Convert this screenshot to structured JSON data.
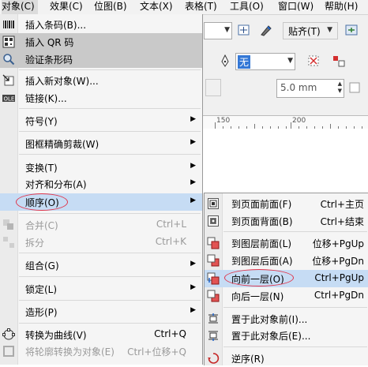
{
  "menubar": [
    {
      "label": "对象(C)",
      "active": true
    },
    {
      "label": "效果(C)"
    },
    {
      "label": "位图(B)"
    },
    {
      "label": "文本(X)"
    },
    {
      "label": "表格(T)"
    },
    {
      "label": "工具(O)"
    },
    {
      "label": "窗口(W)"
    },
    {
      "label": "帮助(H)"
    }
  ],
  "toolbar": {
    "snap_label": "贴齐(T)",
    "outline_value": "无",
    "size_value": "5.0 mm",
    "ruler_labels": [
      "150",
      "200"
    ]
  },
  "menu": {
    "items": [
      {
        "label": "插入条码(B)...",
        "icon": "barcode-icon"
      },
      {
        "label": "插入 QR 码",
        "icon": "qr-code-icon",
        "state": "hover"
      },
      {
        "label": "验证条形码",
        "icon": "magnify-icon",
        "state": "hover"
      },
      {
        "label": "插入新对象(W)...",
        "icon": "insert-object-icon"
      },
      {
        "label": "链接(K)...",
        "icon": "ole-icon"
      },
      {
        "label": "符号(Y)",
        "submenu": true
      },
      {
        "label": "图框精确剪裁(W)",
        "submenu": true
      },
      {
        "label": "变换(T)",
        "submenu": true
      },
      {
        "label": "对齐和分布(A)",
        "submenu": true
      },
      {
        "label": "顺序(O)",
        "submenu": true,
        "state": "open"
      },
      {
        "label": "合并(C)",
        "shortcut": "Ctrl+L",
        "disabled": true,
        "icon": "combine-icon"
      },
      {
        "label": "拆分",
        "shortcut": "Ctrl+K",
        "disabled": true,
        "icon": "break-apart-icon"
      },
      {
        "label": "组合(G)",
        "submenu": true
      },
      {
        "label": "锁定(L)",
        "submenu": true
      },
      {
        "label": "造形(P)",
        "submenu": true
      },
      {
        "label": "转换为曲线(V)",
        "shortcut": "Ctrl+Q",
        "icon": "convert-curves-icon"
      },
      {
        "label": "将轮廓转换为对象(E)",
        "shortcut": "Ctrl+Shift+Q",
        "shortcut_display": "Ctrl+位移+Q",
        "disabled": true,
        "icon": "outline-object-icon"
      }
    ]
  },
  "submenu": {
    "items": [
      {
        "label": "到页面前面(F)",
        "shortcut": "Ctrl+主页",
        "icon": "to-page-front-icon"
      },
      {
        "label": "到页面背面(B)",
        "shortcut": "Ctrl+结束",
        "icon": "to-page-back-icon"
      },
      {
        "label": "到图层前面(L)",
        "shortcut": "位移+PgUp",
        "icon": "to-layer-front-icon"
      },
      {
        "label": "到图层后面(A)",
        "shortcut": "位移+PgDn",
        "icon": "to-layer-back-icon"
      },
      {
        "label": "向前一层(O)",
        "shortcut": "Ctrl+PgUp",
        "icon": "forward-one-icon",
        "state": "hover"
      },
      {
        "label": "向后一层(N)",
        "shortcut": "Ctrl+PgDn",
        "icon": "back-one-icon"
      },
      {
        "label": "置于此对象前(I)...",
        "icon": "in-front-of-icon"
      },
      {
        "label": "置于此对象后(E)...",
        "icon": "behind-icon"
      },
      {
        "label": "逆序(R)",
        "icon": "reverse-order-icon"
      }
    ]
  },
  "colors": {
    "highlight": "#c6dcf4",
    "hover_gray": "#c9c9c9",
    "annotation": "#e0344a"
  }
}
